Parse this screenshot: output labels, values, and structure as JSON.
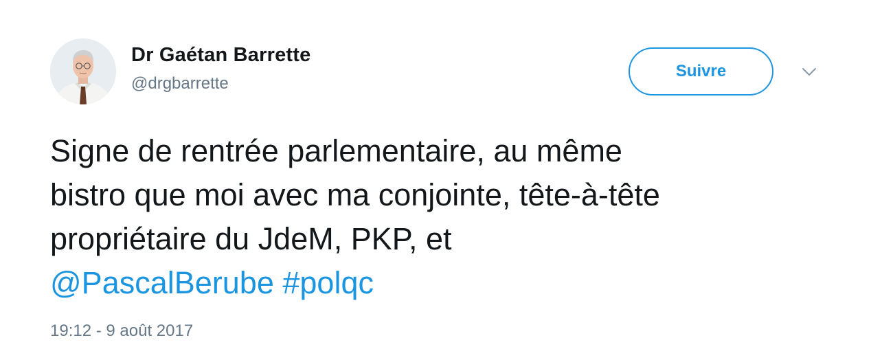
{
  "author": {
    "name": "Dr Gaétan Barrette",
    "handle": "@drgbarrette",
    "avatar_alt": "profile-photo"
  },
  "follow_button": {
    "label": "Suivre"
  },
  "menu": {
    "icon": "chevron-down-icon"
  },
  "tweet": {
    "lines": [
      "Signe de rentrée parlementaire, au même",
      "bistro que moi avec ma conjointe, tête-à-tête",
      "propriétaire du JdeM, PKP, et"
    ],
    "mention": "@PascalBerube",
    "hashtag": "#polqc"
  },
  "timestamp": "19:12 - 9 août 2017",
  "colors": {
    "link": "#1b95e0",
    "text": "#14171a",
    "secondary": "#657786"
  }
}
